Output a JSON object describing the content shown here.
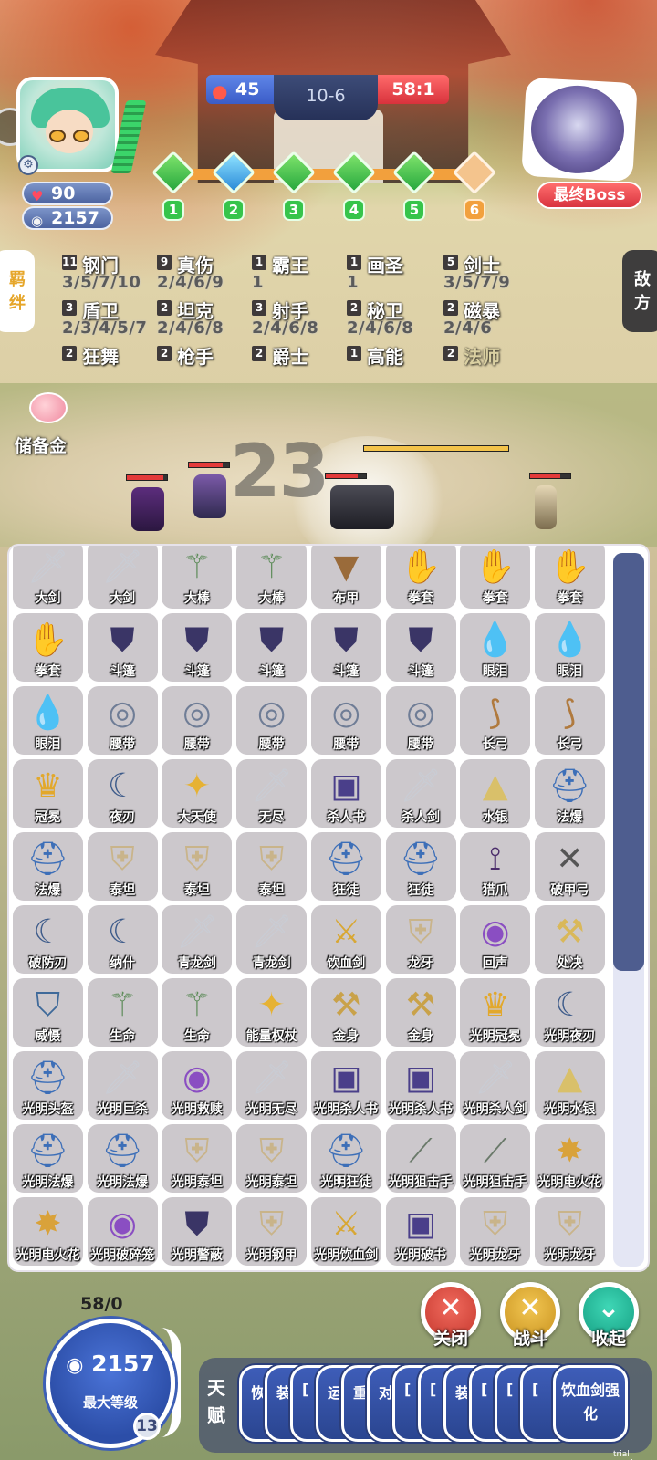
{
  "header": {
    "hp": "90",
    "gold": "2157",
    "fire_count": "45",
    "round": "10-6",
    "enemy_score": "58:1",
    "boss_label": "最终Boss",
    "stages": [
      "1",
      "2",
      "3",
      "4",
      "5",
      "6"
    ]
  },
  "side_tabs": {
    "traits": "羁\n绊",
    "enemy": "敌\n方"
  },
  "traits": [
    {
      "count": "11",
      "name": "钢门",
      "levels": "3/5/7/10"
    },
    {
      "count": "9",
      "name": "真伤",
      "levels": "2/4/6/9"
    },
    {
      "count": "1",
      "name": "霸王",
      "levels": "1"
    },
    {
      "count": "1",
      "name": "画圣",
      "levels": "1"
    },
    {
      "count": "5",
      "name": "剑士",
      "levels": "3/5/7/9"
    },
    {
      "count": "3",
      "name": "盾卫",
      "levels": "2/3/4/5/7"
    },
    {
      "count": "2",
      "name": "坦克",
      "levels": "2/4/6/8"
    },
    {
      "count": "3",
      "name": "射手",
      "levels": "2/4/6/8"
    },
    {
      "count": "2",
      "name": "秘卫",
      "levels": "2/4/6/8"
    },
    {
      "count": "2",
      "name": "磁暴",
      "levels": "2/4/6"
    },
    {
      "count": "2",
      "name": "狂舞",
      "levels": ""
    },
    {
      "count": "2",
      "name": "枪手",
      "levels": ""
    },
    {
      "count": "2",
      "name": "爵士",
      "levels": ""
    },
    {
      "count": "1",
      "name": "高能",
      "levels": ""
    },
    {
      "count": "2",
      "name": "法师",
      "levels": ""
    }
  ],
  "piggy_label": "储备金",
  "battle_timer": "23",
  "inventory": [
    {
      "label": "大剑",
      "icon": "sword-icon"
    },
    {
      "label": "大剑",
      "icon": "sword-icon"
    },
    {
      "label": "大棒",
      "icon": "staff-icon"
    },
    {
      "label": "大棒",
      "icon": "staff-icon"
    },
    {
      "label": "布甲",
      "icon": "vest-icon"
    },
    {
      "label": "拳套",
      "icon": "glove-icon"
    },
    {
      "label": "拳套",
      "icon": "glove-icon"
    },
    {
      "label": "拳套",
      "icon": "glove-icon"
    },
    {
      "label": "拳套",
      "icon": "glove-icon"
    },
    {
      "label": "斗篷",
      "icon": "cloak-icon"
    },
    {
      "label": "斗篷",
      "icon": "cloak-icon"
    },
    {
      "label": "斗篷",
      "icon": "cloak-icon"
    },
    {
      "label": "斗篷",
      "icon": "cloak-icon"
    },
    {
      "label": "斗篷",
      "icon": "cloak-icon"
    },
    {
      "label": "眼泪",
      "icon": "tear-icon"
    },
    {
      "label": "眼泪",
      "icon": "tear-icon"
    },
    {
      "label": "眼泪",
      "icon": "tear-icon"
    },
    {
      "label": "腰带",
      "icon": "belt-icon"
    },
    {
      "label": "腰带",
      "icon": "belt-icon"
    },
    {
      "label": "腰带",
      "icon": "belt-icon"
    },
    {
      "label": "腰带",
      "icon": "belt-icon"
    },
    {
      "label": "腰带",
      "icon": "belt-icon"
    },
    {
      "label": "长弓",
      "icon": "bow-icon"
    },
    {
      "label": "长弓",
      "icon": "bow-icon"
    },
    {
      "label": "冠冕",
      "icon": "crown-icon"
    },
    {
      "label": "夜刃",
      "icon": "blade-icon"
    },
    {
      "label": "大天使",
      "icon": "scepter-icon"
    },
    {
      "label": "无尽",
      "icon": "sword-icon"
    },
    {
      "label": "杀人书",
      "icon": "book-icon"
    },
    {
      "label": "杀人剑",
      "icon": "sword-icon"
    },
    {
      "label": "水银",
      "icon": "cape-icon"
    },
    {
      "label": "法爆",
      "icon": "helm-icon"
    },
    {
      "label": "法爆",
      "icon": "helm-icon"
    },
    {
      "label": "泰坦",
      "icon": "armor-icon"
    },
    {
      "label": "泰坦",
      "icon": "armor-icon"
    },
    {
      "label": "泰坦",
      "icon": "armor-icon"
    },
    {
      "label": "狂徒",
      "icon": "helm-icon"
    },
    {
      "label": "狂徒",
      "icon": "helm-icon"
    },
    {
      "label": "猎爪",
      "icon": "claw-icon"
    },
    {
      "label": "破甲弓",
      "icon": "crossbow-icon"
    },
    {
      "label": "破防刃",
      "icon": "blade-icon"
    },
    {
      "label": "纳什",
      "icon": "blade-icon"
    },
    {
      "label": "青龙剑",
      "icon": "sword-icon"
    },
    {
      "label": "青龙剑",
      "icon": "sword-icon"
    },
    {
      "label": "饮血剑",
      "icon": "scythe-icon"
    },
    {
      "label": "龙牙",
      "icon": "armor-icon"
    },
    {
      "label": "回声",
      "icon": "orb-icon"
    },
    {
      "label": "处决",
      "icon": "axe-icon"
    },
    {
      "label": "威慑",
      "icon": "shield-icon"
    },
    {
      "label": "生命",
      "icon": "staff-icon"
    },
    {
      "label": "生命",
      "icon": "staff-icon"
    },
    {
      "label": "能量权杖",
      "icon": "scepter-icon"
    },
    {
      "label": "金身",
      "icon": "hammer-icon"
    },
    {
      "label": "金身",
      "icon": "hammer-icon"
    },
    {
      "label": "光明冠冕",
      "icon": "crown-icon"
    },
    {
      "label": "光明夜刃",
      "icon": "blade-icon"
    },
    {
      "label": "光明头盔",
      "icon": "helm-icon"
    },
    {
      "label": "光明巨杀",
      "icon": "sword-icon"
    },
    {
      "label": "光明救赎",
      "icon": "orb-icon"
    },
    {
      "label": "光明无尽",
      "icon": "sword-icon"
    },
    {
      "label": "光明杀人书",
      "icon": "book-icon"
    },
    {
      "label": "光明杀人书",
      "icon": "book-icon"
    },
    {
      "label": "光明杀人剑",
      "icon": "sword-icon"
    },
    {
      "label": "光明水银",
      "icon": "cape-icon"
    },
    {
      "label": "光明法爆",
      "icon": "helm-icon"
    },
    {
      "label": "光明法爆",
      "icon": "helm-icon"
    },
    {
      "label": "光明泰坦",
      "icon": "armor-icon"
    },
    {
      "label": "光明泰坦",
      "icon": "armor-icon"
    },
    {
      "label": "光明狂徒",
      "icon": "helm-icon"
    },
    {
      "label": "光明狙击手",
      "icon": "rifle-icon"
    },
    {
      "label": "光明狙击手",
      "icon": "rifle-icon"
    },
    {
      "label": "光明电火花",
      "icon": "spark-icon"
    },
    {
      "label": "光明电火花",
      "icon": "spark-icon"
    },
    {
      "label": "光明破碎笼",
      "icon": "orb-icon"
    },
    {
      "label": "光明警蔽",
      "icon": "cloak-icon"
    },
    {
      "label": "光明钢甲",
      "icon": "armor-icon"
    },
    {
      "label": "光明饮血剑",
      "icon": "scythe-icon"
    },
    {
      "label": "光明破书",
      "icon": "book-icon"
    },
    {
      "label": "光明龙牙",
      "icon": "armor-icon"
    },
    {
      "label": "光明龙牙",
      "icon": "armor-icon"
    }
  ],
  "bottom": {
    "level_count": "58/0",
    "gold": "2157",
    "max_level": "最大等级",
    "level_badge": "13",
    "close": "关闭",
    "fight": "战斗",
    "collapse": "收起",
    "talent_title": "天赋",
    "talents": [
      "恢",
      "装",
      "[",
      "运",
      "重",
      "对",
      "[",
      "[",
      "装",
      "[",
      "[",
      "["
    ],
    "talent_last": "饮血剑强化",
    "trial": "trial version"
  }
}
